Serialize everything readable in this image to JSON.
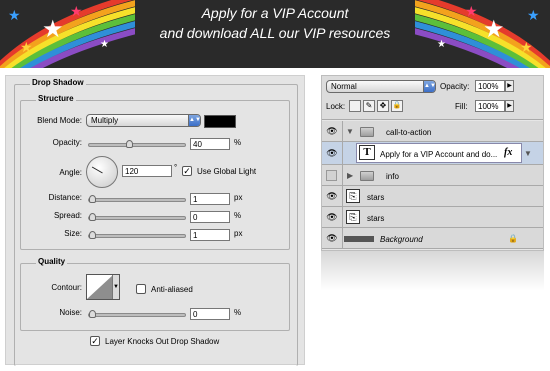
{
  "banner": {
    "line1": "Apply for a VIP Account",
    "line2": "and download ALL our VIP resources"
  },
  "drop_shadow": {
    "title": "Drop Shadow",
    "structure": {
      "title": "Structure",
      "blend_mode_label": "Blend Mode:",
      "blend_mode_value": "Multiply",
      "shadow_color": "#000000",
      "opacity_label": "Opacity:",
      "opacity_value": "40",
      "opacity_unit": "%",
      "opacity_level": 0.4,
      "angle_label": "Angle:",
      "angle_value": "120",
      "angle_unit": "°",
      "use_global_light_label": "Use Global Light",
      "use_global_light_checked": true,
      "distance_label": "Distance:",
      "distance_value": "1",
      "distance_unit": "px",
      "spread_label": "Spread:",
      "spread_value": "0",
      "spread_unit": "%",
      "size_label": "Size:",
      "size_value": "1",
      "size_unit": "px"
    },
    "quality": {
      "title": "Quality",
      "contour_label": "Contour:",
      "anti_aliased_label": "Anti-aliased",
      "anti_aliased_checked": false,
      "noise_label": "Noise:",
      "noise_value": "0",
      "noise_unit": "%"
    },
    "knocks_out_label": "Layer Knocks Out Drop Shadow",
    "knocks_out_checked": true
  },
  "layers": {
    "blend_mode": "Normal",
    "opacity_label": "Opacity:",
    "opacity_value": "100%",
    "lock_label": "Lock:",
    "fill_label": "Fill:",
    "fill_value": "100%",
    "rows": [
      {
        "name": "call-to-action",
        "type": "group",
        "expanded": true,
        "visible": true
      },
      {
        "name": "Apply for a VIP Account  and do...",
        "type": "text",
        "selected": true,
        "visible": true,
        "fx": "fx"
      },
      {
        "name": "info",
        "type": "group",
        "expanded": false,
        "visible": false
      },
      {
        "name": "stars",
        "type": "smart",
        "visible": true
      },
      {
        "name": "stars",
        "type": "smart",
        "visible": true
      },
      {
        "name": "Background",
        "type": "background",
        "visible": true,
        "locked": true
      }
    ]
  }
}
